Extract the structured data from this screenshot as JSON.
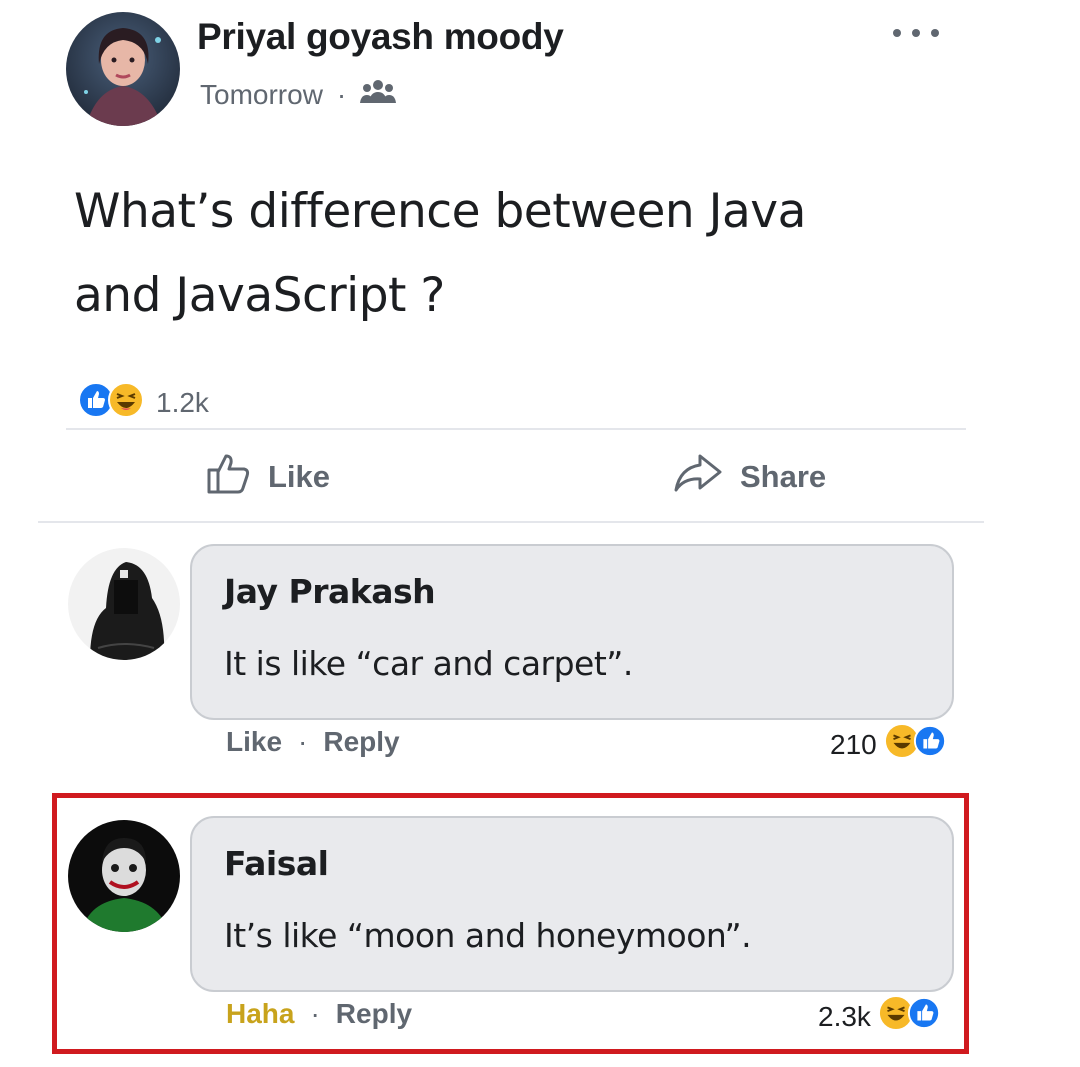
{
  "post": {
    "author": "Priyal goyash moody",
    "time": "Tomorrow",
    "meta_separator": "·",
    "privacy_icon": "friends-icon",
    "text_line1": "What’s difference between Java",
    "text_line2": "and JavaScript ?",
    "reaction_count": "1.2k",
    "reactions": [
      "like",
      "haha"
    ]
  },
  "actions": {
    "like_label": "Like",
    "share_label": "Share"
  },
  "comments": [
    {
      "name": "Jay Prakash",
      "text": "It is like “car and carpet”.",
      "action_primary": "Like",
      "separator": "·",
      "action_reply": "Reply",
      "reaction_count": "210"
    },
    {
      "name": "Faisal",
      "text": "It’s like “moon and honeymoon”.",
      "action_primary": "Haha",
      "separator": "·",
      "action_reply": "Reply",
      "reaction_count": "2.3k",
      "highlighted": true
    }
  ],
  "colors": {
    "like_blue": "#1877f2",
    "haha_yellow": "#f7b928",
    "secondary_text": "#606770",
    "highlight_border": "#d01a1f",
    "haha_label": "#c8a31c"
  }
}
